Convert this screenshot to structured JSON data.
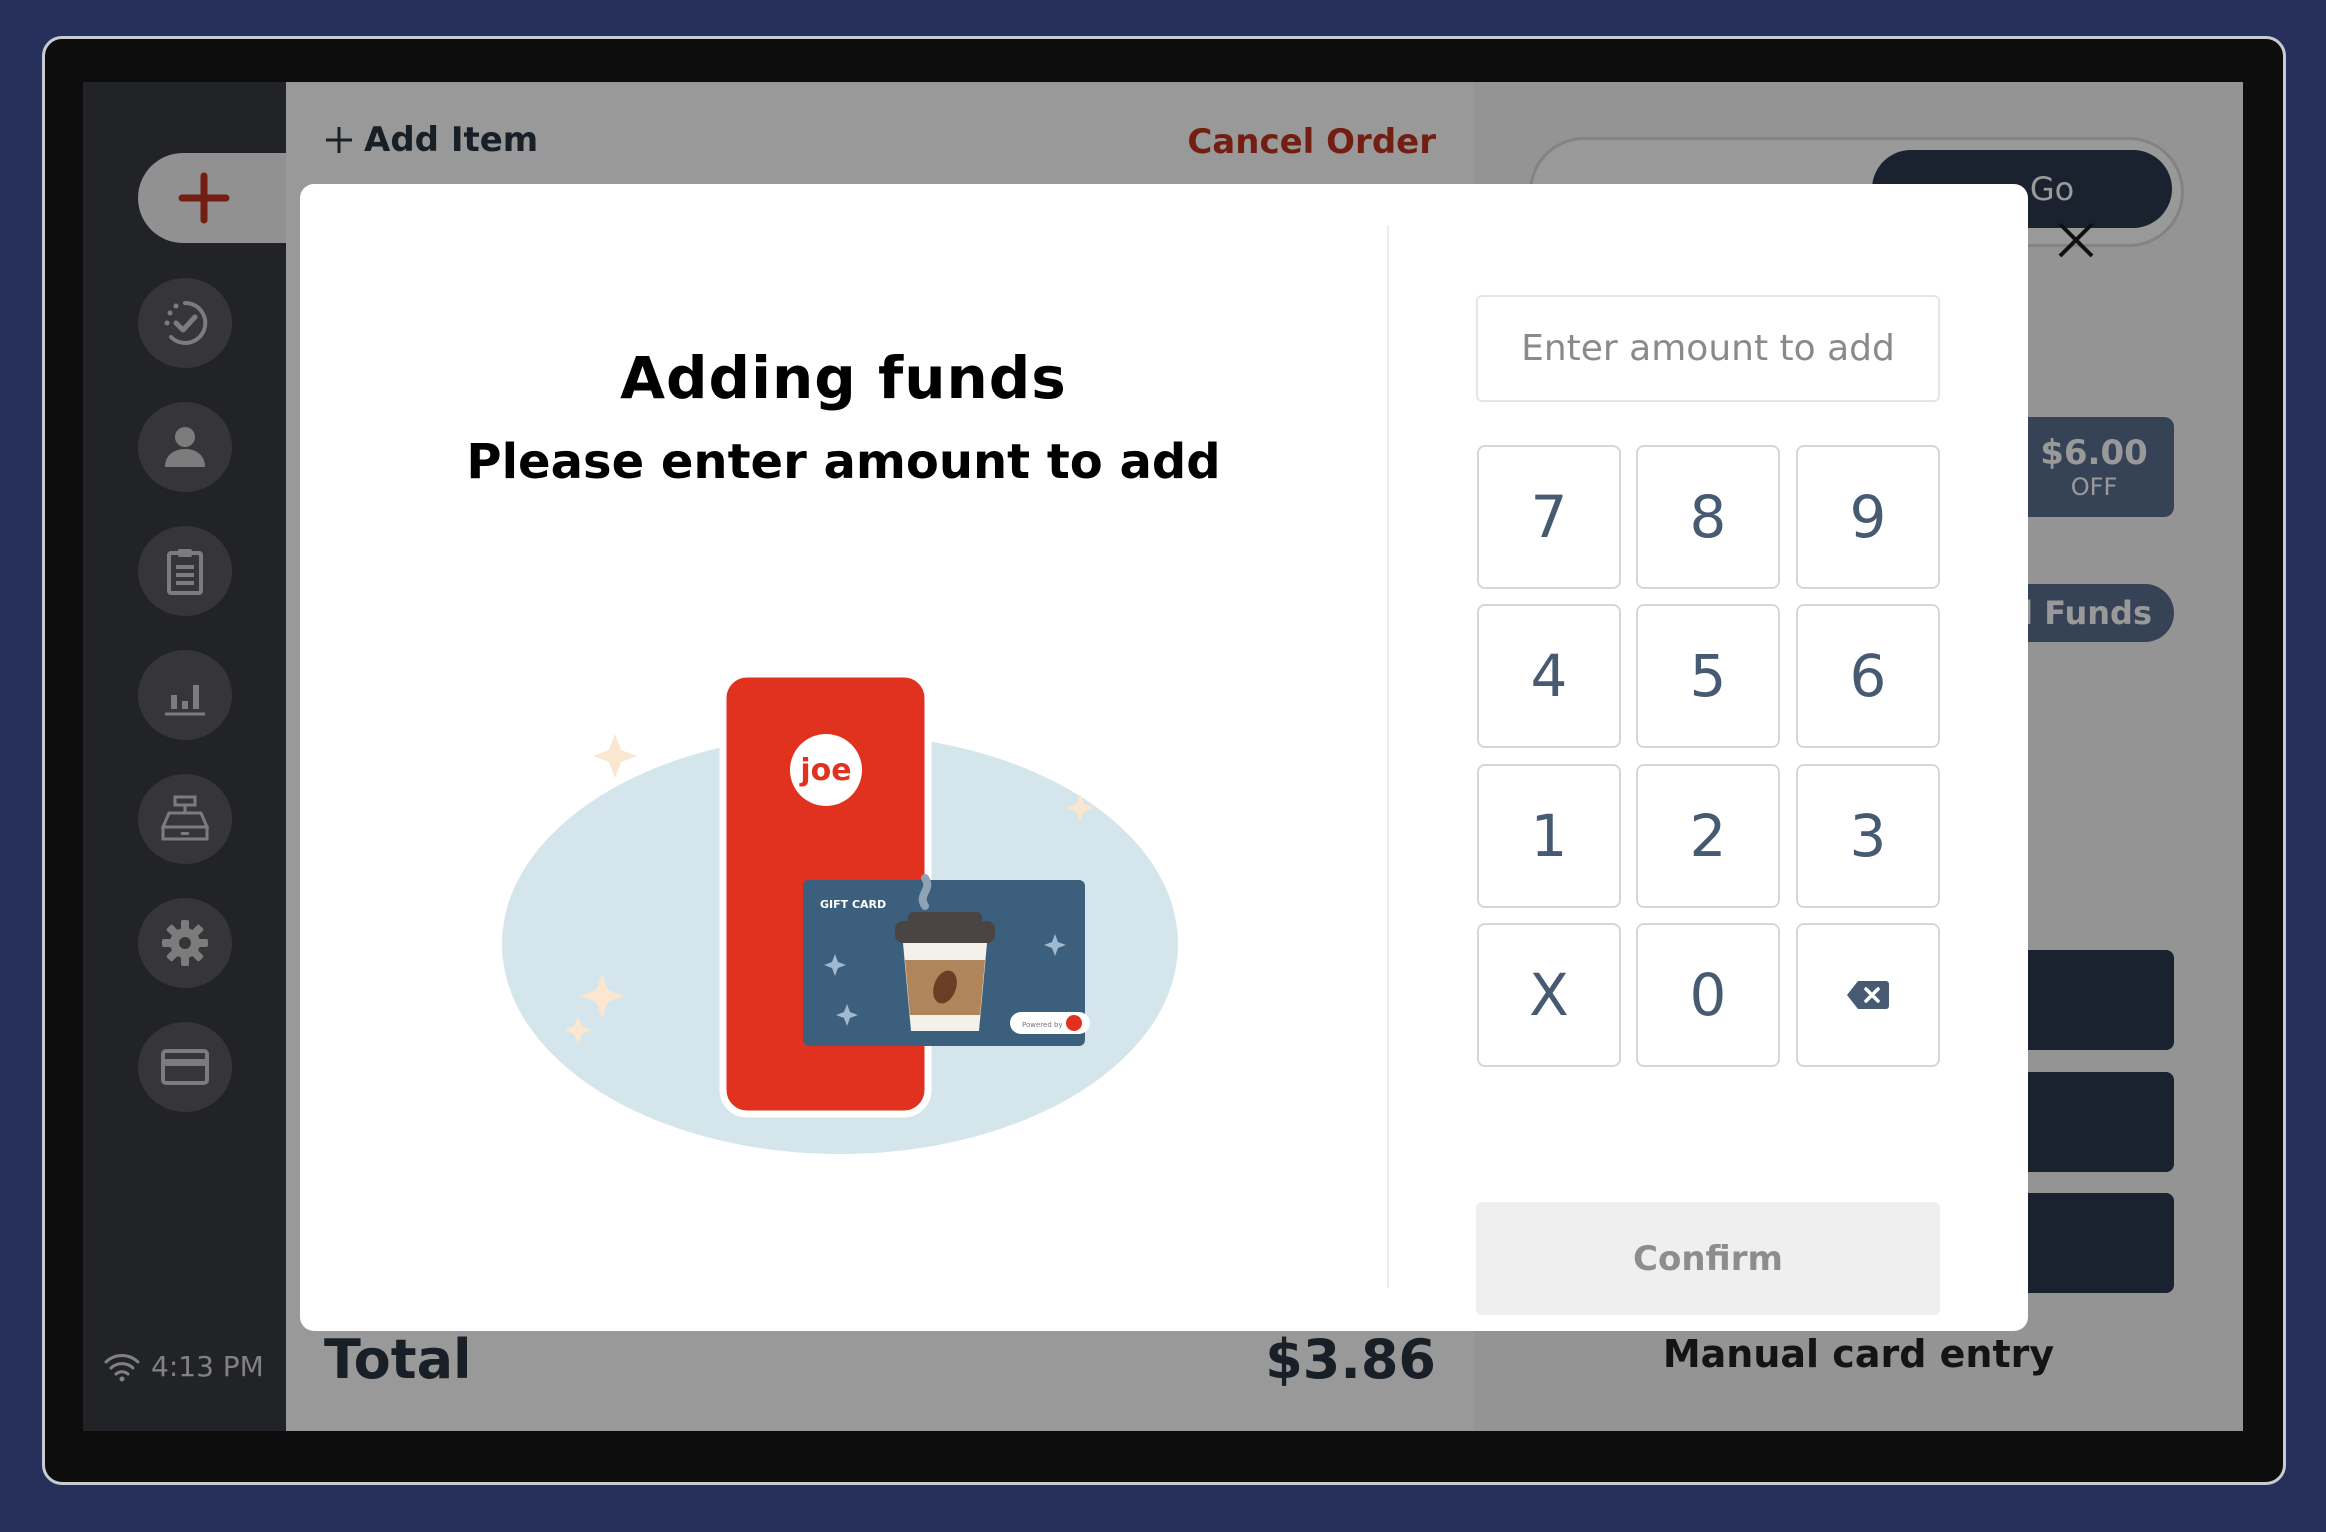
{
  "sidebar": {
    "new_order_icon": "plus-icon",
    "items": [
      {
        "id": "orders-status",
        "icon": "clock-check-icon"
      },
      {
        "id": "customers",
        "icon": "user-icon"
      },
      {
        "id": "orders",
        "icon": "clipboard-icon"
      },
      {
        "id": "reports",
        "icon": "bar-chart-icon"
      },
      {
        "id": "register",
        "icon": "cash-register-icon"
      },
      {
        "id": "settings",
        "icon": "gear-icon"
      },
      {
        "id": "payments",
        "icon": "credit-card-icon"
      }
    ],
    "status": {
      "wifi_icon": "wifi-icon",
      "time": "4:13 PM"
    }
  },
  "main": {
    "add_item_label": "Add Item",
    "cancel_order_label": "Cancel Order",
    "total_label": "Total",
    "total_value": "$3.86"
  },
  "right_panel": {
    "go_label": "Go",
    "discount_amount": "$6.00",
    "discount_suffix": "OFF",
    "add_funds_label": "Add Funds",
    "manual_entry_label": "Manual card entry"
  },
  "modal": {
    "title": "Adding funds",
    "subtitle": "Please enter amount to add",
    "amount_input": {
      "value": "",
      "placeholder": "Enter amount to add"
    },
    "keypad": [
      {
        "label": "7"
      },
      {
        "label": "8"
      },
      {
        "label": "9"
      },
      {
        "label": "4"
      },
      {
        "label": "5"
      },
      {
        "label": "6"
      },
      {
        "label": "1"
      },
      {
        "label": "2"
      },
      {
        "label": "3"
      },
      {
        "label": "X"
      },
      {
        "label": "0"
      },
      {
        "label": "",
        "icon": "backspace-icon"
      }
    ],
    "confirm_label": "Confirm",
    "close_icon": "close-icon",
    "illustration": {
      "brand": "joe",
      "card_label": "GIFT CARD",
      "powered_by": "Powered by"
    }
  },
  "colors": {
    "accent_red": "#c0321f",
    "navy": "#2d3a4f",
    "keypad_text": "#465a72",
    "phone_red": "#e0321f",
    "card_blue": "#3d5f7e"
  }
}
